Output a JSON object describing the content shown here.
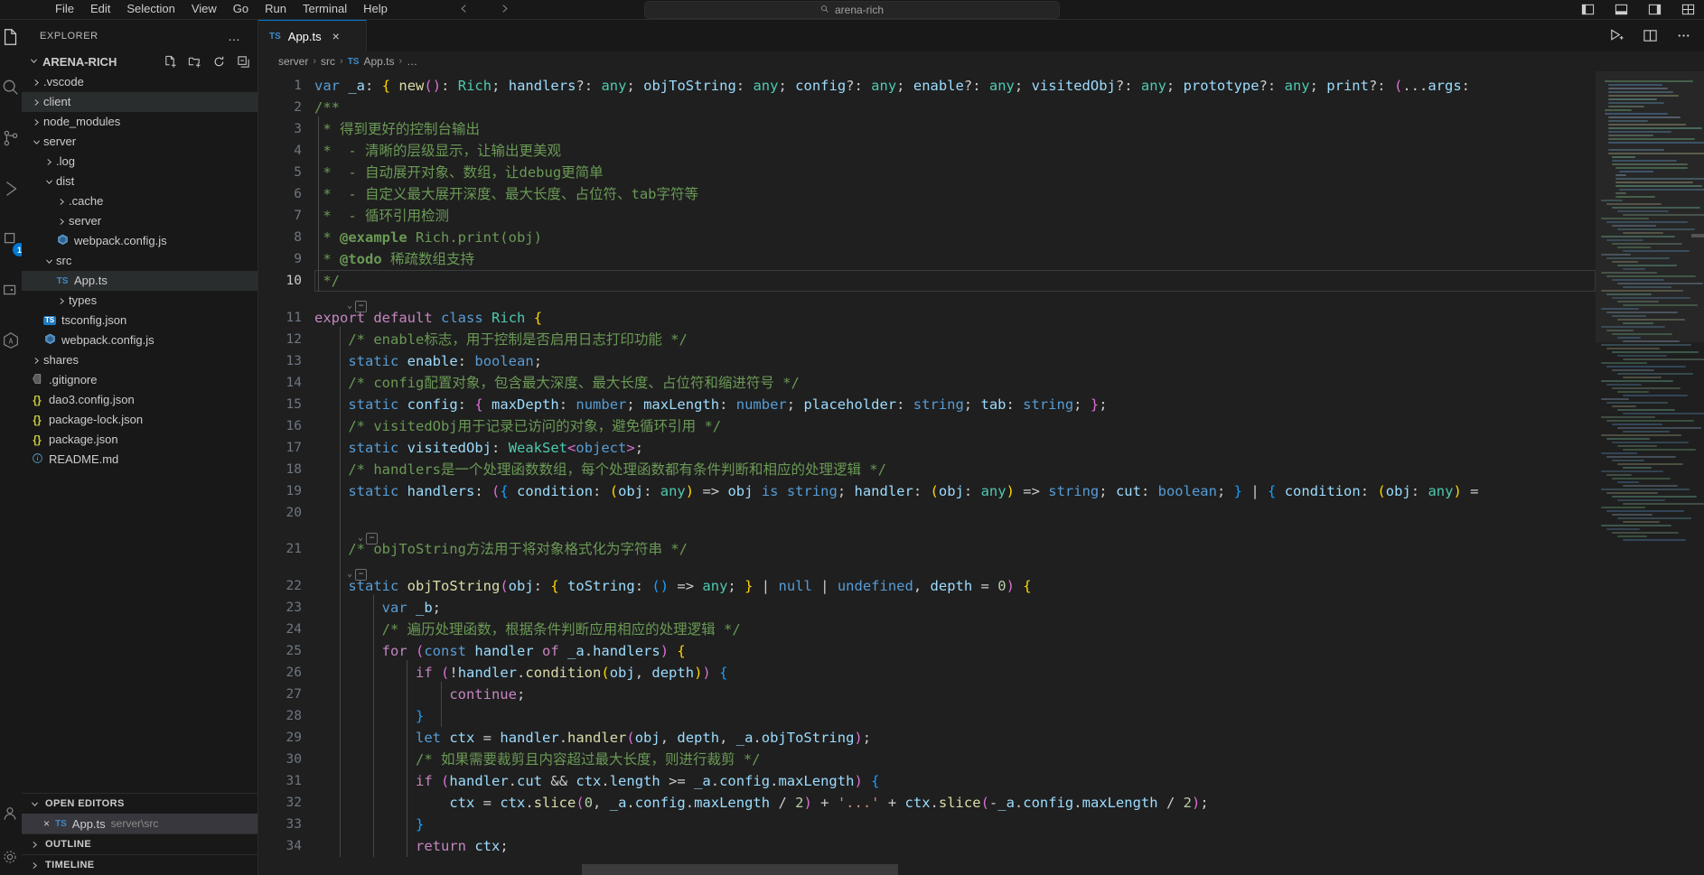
{
  "titlebar": {
    "menus": [
      "File",
      "Edit",
      "Selection",
      "View",
      "Go",
      "Run",
      "Terminal",
      "Help"
    ],
    "back_icon": "chevron-left-icon",
    "forward_icon": "chevron-right-icon",
    "search_placeholder": "arena-rich",
    "search_icon": "search-icon",
    "layout_icons": [
      "toggle-primary-sidebar-icon",
      "toggle-panel-icon",
      "toggle-secondary-sidebar-icon",
      "customize-layout-icon"
    ]
  },
  "activitybar": {
    "items": [
      {
        "name": "explorer-icon",
        "glyph": "files"
      },
      {
        "name": "search-icon",
        "glyph": "search"
      },
      {
        "name": "source-control-icon",
        "glyph": "branch"
      },
      {
        "name": "run-and-debug-icon",
        "glyph": "debug"
      },
      {
        "name": "extensions-icon",
        "glyph": "extensions",
        "badge": "1"
      },
      {
        "name": "remote-explorer-icon",
        "glyph": "remote"
      },
      {
        "name": "testing-icon",
        "glyph": "beaker"
      }
    ],
    "bottom": [
      {
        "name": "accounts-icon",
        "glyph": "account"
      },
      {
        "name": "manage-settings-icon",
        "glyph": "gear"
      }
    ]
  },
  "sidebar": {
    "title": "EXPLORER",
    "more_actions": "…",
    "root": {
      "label": "ARENA-RICH",
      "actions": [
        "new-file-icon",
        "new-folder-icon",
        "refresh-explorer-icon",
        "collapse-folders-icon"
      ]
    },
    "tree": [
      {
        "label": ".vscode",
        "depth": 1,
        "kind": "folder",
        "expanded": false,
        "selected": false
      },
      {
        "label": "client",
        "depth": 1,
        "kind": "folder",
        "expanded": false,
        "selected": true
      },
      {
        "label": "node_modules",
        "depth": 1,
        "kind": "folder",
        "expanded": false,
        "selected": false
      },
      {
        "label": "server",
        "depth": 1,
        "kind": "folder",
        "expanded": true,
        "selected": false
      },
      {
        "label": ".log",
        "depth": 2,
        "kind": "folder",
        "expanded": false,
        "selected": false
      },
      {
        "label": "dist",
        "depth": 2,
        "kind": "folder",
        "expanded": true,
        "selected": false
      },
      {
        "label": ".cache",
        "depth": 3,
        "kind": "folder",
        "expanded": false,
        "selected": false
      },
      {
        "label": "server",
        "depth": 3,
        "kind": "folder",
        "expanded": false,
        "selected": false
      },
      {
        "label": "webpack.config.js",
        "depth": 3,
        "kind": "webpack",
        "expanded": null,
        "selected": false
      },
      {
        "label": "src",
        "depth": 2,
        "kind": "folder",
        "expanded": true,
        "selected": false
      },
      {
        "label": "App.ts",
        "depth": 3,
        "kind": "ts",
        "expanded": null,
        "selected": true
      },
      {
        "label": "types",
        "depth": 3,
        "kind": "folder",
        "expanded": false,
        "selected": false
      },
      {
        "label": "tsconfig.json",
        "depth": 2,
        "kind": "tsjson",
        "expanded": null,
        "selected": false
      },
      {
        "label": "webpack.config.js",
        "depth": 2,
        "kind": "webpack",
        "expanded": null,
        "selected": false
      },
      {
        "label": "shares",
        "depth": 1,
        "kind": "folder",
        "expanded": false,
        "selected": false
      },
      {
        "label": ".gitignore",
        "depth": 1,
        "kind": "git",
        "expanded": null,
        "selected": false
      },
      {
        "label": "dao3.config.json",
        "depth": 1,
        "kind": "json",
        "expanded": null,
        "selected": false
      },
      {
        "label": "package-lock.json",
        "depth": 1,
        "kind": "json",
        "expanded": null,
        "selected": false
      },
      {
        "label": "package.json",
        "depth": 1,
        "kind": "json",
        "expanded": null,
        "selected": false
      },
      {
        "label": "README.md",
        "depth": 1,
        "kind": "md",
        "expanded": null,
        "selected": false
      }
    ],
    "panels": [
      {
        "label": "OPEN EDITORS",
        "expanded": true
      },
      {
        "label": "OUTLINE",
        "expanded": false
      },
      {
        "label": "TIMELINE",
        "expanded": false
      }
    ],
    "open_editors": [
      {
        "name": "App.ts",
        "path": "server\\src",
        "icon": "ts-file-icon",
        "close": "×"
      }
    ]
  },
  "editor": {
    "tabs": [
      {
        "label": "App.ts",
        "icon": "ts-file-icon",
        "close": "×",
        "active": true
      }
    ],
    "actions": [
      "run-code-icon",
      "split-editor-icon",
      "more-actions-icon"
    ],
    "breadcrumbs": [
      "server",
      "src",
      "App.ts",
      "…"
    ],
    "lines": [
      {
        "n": 1,
        "indent": 0
      },
      {
        "n": 2,
        "indent": 0
      },
      {
        "n": 3,
        "indent": 0
      },
      {
        "n": 4,
        "indent": 0
      },
      {
        "n": 5,
        "indent": 0
      },
      {
        "n": 6,
        "indent": 0
      },
      {
        "n": 7,
        "indent": 0
      },
      {
        "n": 8,
        "indent": 0
      },
      {
        "n": 9,
        "indent": 0
      },
      {
        "n": 10,
        "indent": 0
      },
      {
        "n": 11,
        "indent": 0
      },
      {
        "n": 12,
        "indent": 1
      },
      {
        "n": 13,
        "indent": 1
      },
      {
        "n": 14,
        "indent": 1
      },
      {
        "n": 15,
        "indent": 1
      },
      {
        "n": 16,
        "indent": 1
      },
      {
        "n": 17,
        "indent": 1
      },
      {
        "n": 18,
        "indent": 1
      },
      {
        "n": 19,
        "indent": 1
      },
      {
        "n": 20,
        "indent": 1
      },
      {
        "n": 21,
        "indent": 1
      },
      {
        "n": 22,
        "indent": 1
      },
      {
        "n": 23,
        "indent": 2
      },
      {
        "n": 24,
        "indent": 2
      },
      {
        "n": 25,
        "indent": 2
      },
      {
        "n": 26,
        "indent": 3
      },
      {
        "n": 27,
        "indent": 4
      },
      {
        "n": 28,
        "indent": 3
      },
      {
        "n": 29,
        "indent": 3
      },
      {
        "n": 30,
        "indent": 3
      },
      {
        "n": 31,
        "indent": 3
      },
      {
        "n": 32,
        "indent": 4
      },
      {
        "n": 33,
        "indent": 3
      },
      {
        "n": 34,
        "indent": 3
      }
    ],
    "source_text": {
      "l1": "var _a: { new(): Rich; handlers?: any; objToString: any; config?: any; enable?: any; visitedObj?: any; prototype?: any; print?: (...args:",
      "l2": "/**",
      "l3": " * 得到更好的控制台输出",
      "l4": " *  - 清晰的层级显示，让输出更美观",
      "l5": " *  - 自动展开对象、数组，让debug更简单",
      "l6": " *  - 自定义最大展开深度、最大长度、占位符、tab字符等",
      "l7": " *  - 循环引用检测",
      "l8": " * @example Rich.print(obj)",
      "l9": " * @todo 稀疏数组支持",
      "l10": " */",
      "l11": "export default class Rich {",
      "l12": "/* enable标志，用于控制是否启用日志打印功能 */",
      "l13": "static enable: boolean;",
      "l14": "/* config配置对象，包含最大深度、最大长度、占位符和缩进符号 */",
      "l15": "static config: { maxDepth: number; maxLength: number; placeholder: string; tab: string; };",
      "l16": "/* visitedObj用于记录已访问的对象，避免循环引用 */",
      "l17": "static visitedObj: WeakSet<object>;",
      "l18": "/* handlers是一个处理函数数组，每个处理函数都有条件判断和相应的处理逻辑 */",
      "l19": "static handlers: ({ condition: (obj: any) => obj is string; handler: (obj: any) => string; cut: boolean; } | { condition: (obj: any) =",
      "l20": "",
      "l21": "/* objToString方法用于将对象格式化为字符串 */",
      "l22": "static objToString(obj: { toString: () => any; } | null | undefined, depth = 0) {",
      "l23": "var _b;",
      "l24": "/* 遍历处理函数，根据条件判断应用相应的处理逻辑 */",
      "l25": "for (const handler of _a.handlers) {",
      "l26": "if (!handler.condition(obj, depth)) {",
      "l27": "continue;",
      "l28": "}",
      "l29": "let ctx = handler.handler(obj, depth, _a.objToString);",
      "l30": "/* 如果需要裁剪且内容超过最大长度，则进行裁剪 */",
      "l31": "if (handler.cut && ctx.length >= _a.config.maxLength) {",
      "l32": "ctx = ctx.slice(0, _a.config.maxLength / 2) + '...' + ctx.slice(-_a.config.maxLength / 2);",
      "l33": "}",
      "l34": "return ctx;"
    },
    "current_line": 10,
    "fold_markers": [
      "inlay-hint-10",
      "inlay-hint-20",
      "inlay-hint-21"
    ]
  },
  "colors": {
    "accent": "#0078d4",
    "editor_bg": "#1f1f1f",
    "chrome_bg": "#181818",
    "selection": "#2a2d2e",
    "comment": "#6a9955",
    "keyword": "#569cd6",
    "type": "#4ec9b0",
    "identifier": "#9cdcfe",
    "string": "#ce9178",
    "number": "#b5cea8",
    "control": "#c586c0"
  }
}
